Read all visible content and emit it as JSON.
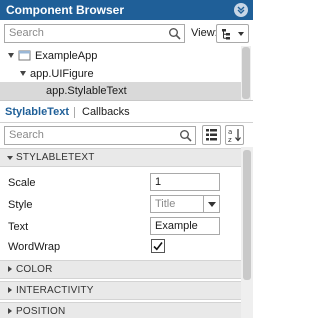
{
  "panel": {
    "title": "Component Browser"
  },
  "browser_search": {
    "placeholder": "Search"
  },
  "view": {
    "label": "View:"
  },
  "tree": {
    "items": [
      {
        "label": "ExampleApp",
        "level": 0,
        "selected": false
      },
      {
        "label": "app.UIFigure",
        "level": 1,
        "selected": false
      },
      {
        "label": "app.StylableText",
        "level": 2,
        "selected": true
      }
    ]
  },
  "tabs": [
    {
      "label": "StylableText",
      "active": true
    },
    {
      "label": "Callbacks",
      "active": false
    }
  ],
  "inspector_search": {
    "placeholder": "Search"
  },
  "sections": {
    "stylabletext": "STYLABLETEXT",
    "color": "COLOR",
    "interactivity": "INTERACTIVITY",
    "position": "POSITION"
  },
  "properties": {
    "scale": {
      "label": "Scale",
      "value": "1"
    },
    "style": {
      "label": "Style",
      "value": "Title"
    },
    "text": {
      "label": "Text",
      "value": "Example"
    },
    "wordwrap": {
      "label": "WordWrap",
      "checked": true
    }
  },
  "colors": {
    "title_bar": "#1f5f98",
    "active_tab": "#1f5f98",
    "selected_row": "#d9d9d9"
  }
}
